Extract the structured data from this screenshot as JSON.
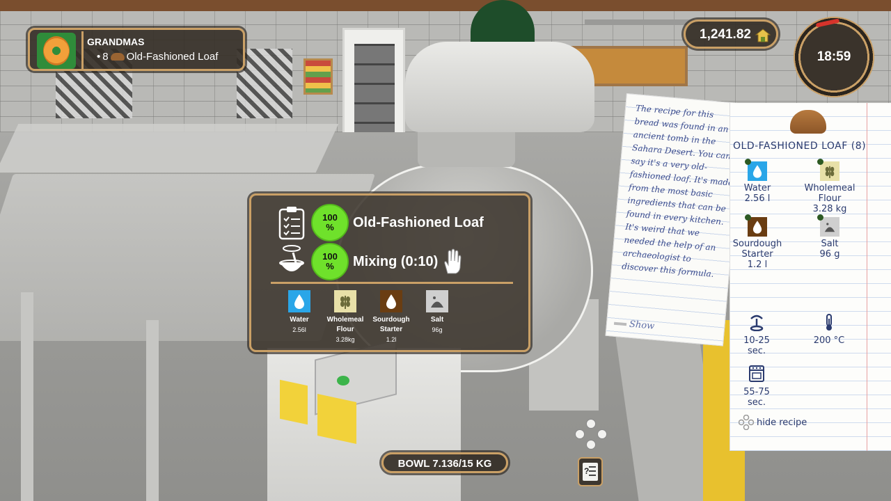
{
  "order": {
    "customer": "GRANDMAS",
    "bullet": "•",
    "quantity": "8",
    "item": "Old-Fashioned Loaf"
  },
  "money": {
    "amount": "1,241.82"
  },
  "clock": {
    "time": "18:59"
  },
  "progress_panel": {
    "recipe_percent": "100\n%",
    "recipe_name": "Old-Fashioned Loaf",
    "mixing_percent": "100\n%",
    "mixing_label": "Mixing (0:10)",
    "ingredients": [
      {
        "name": "Water",
        "amount": "2.56l",
        "color": "#2aa6e8"
      },
      {
        "name": "Wholemeal Flour",
        "amount": "3.28kg",
        "color": "#e8e0a8"
      },
      {
        "name": "Sourdough Starter",
        "amount": "1.2l",
        "color": "#6a3d12"
      },
      {
        "name": "Salt",
        "amount": "96g",
        "color": "#cfcfcf"
      }
    ]
  },
  "bowl": {
    "label": "BOWL 7.136/15 KG"
  },
  "story_note": {
    "text": "The recipe for this bread was found in an ancient tomb in the Sahara Desert. You can say it's a very old-fashioned loaf. It's made from the most basic ingredients that can be found in every kitchen. It's weird that we needed the help of an archaeologist to discover this formula.",
    "show_label": "Show"
  },
  "recipe_card": {
    "title": "OLD-FASHIONED LOAF (8)",
    "ingredients": [
      {
        "name": "Water",
        "amount": "2.56 l",
        "color": "#2aa6e8"
      },
      {
        "name": "Wholemeal Flour",
        "amount": "3.28 kg",
        "color": "#e8e0a8"
      },
      {
        "name": "Sourdough Starter",
        "amount": "1.2 l",
        "color": "#6a3d12"
      },
      {
        "name": "Salt",
        "amount": "96 g",
        "color": "#cfcfcf"
      }
    ],
    "mix_time": "10-25 sec.",
    "temperature": "200 °C",
    "bake_time": "55-75 sec.",
    "hide_label": "hide recipe"
  },
  "colors": {
    "accent": "#caa066",
    "progress_green": "#6fe12b",
    "ink": "#2a3a6e"
  }
}
